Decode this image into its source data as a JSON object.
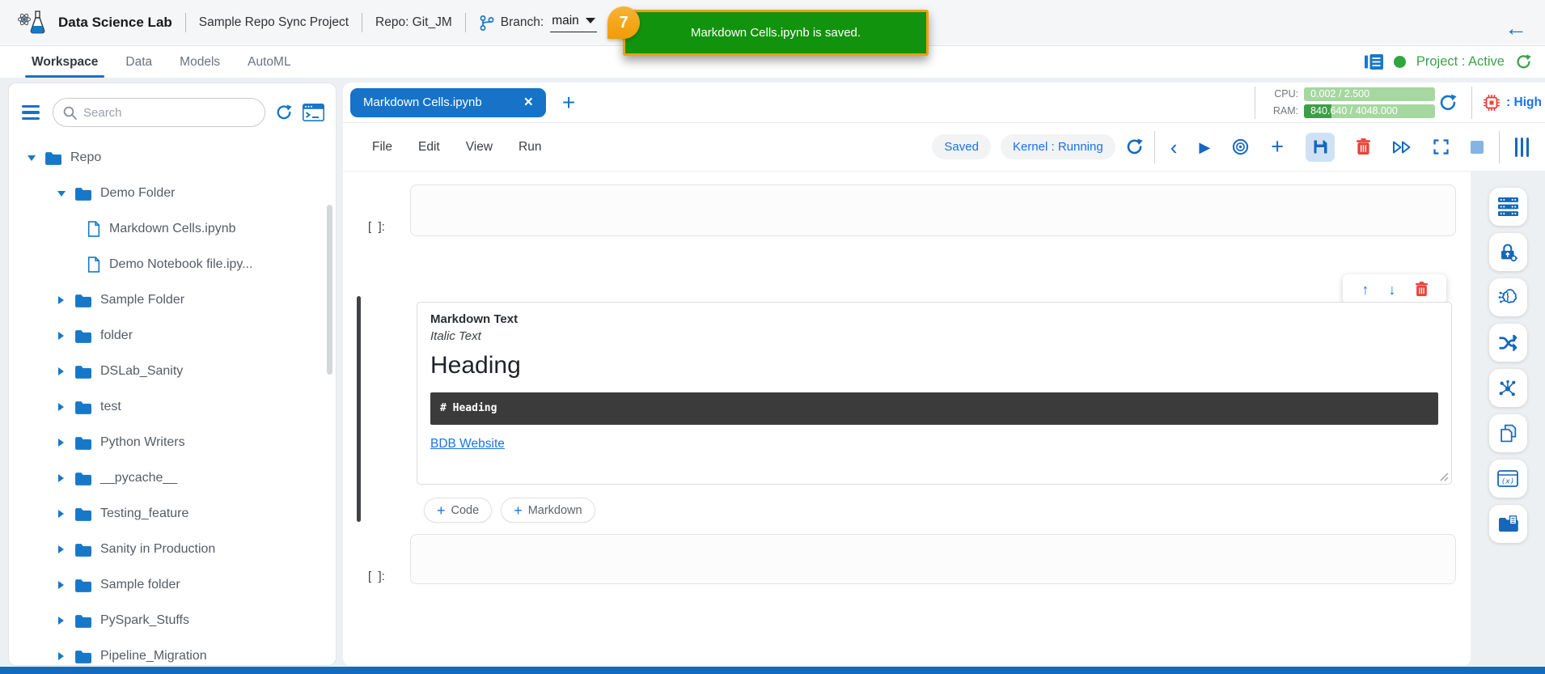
{
  "colors": {
    "accent": "#1673c8",
    "toast_green": "#12930e",
    "badge_orange": "#f0a30a",
    "status_green": "#3fa14b",
    "danger_red": "#e8453c"
  },
  "header": {
    "app_title": "Data Science Lab",
    "project_name": "Sample Repo Sync Project",
    "repo_label": "Repo: Git_JM",
    "branch_label": "Branch:",
    "branch_value": "main",
    "back_icon": "←"
  },
  "toast": {
    "badge": "7",
    "message": "Markdown Cells.ipynb is saved."
  },
  "nav": {
    "tabs": [
      "Workspace",
      "Data",
      "Models",
      "AutoML"
    ],
    "project_status": "Project : Active"
  },
  "sidebar": {
    "search_placeholder": "Search",
    "tree": [
      {
        "label": "Repo",
        "type": "folder",
        "expanded": true
      },
      {
        "label": "Demo Folder",
        "type": "folder",
        "expanded": true
      },
      {
        "label": "Markdown Cells.ipynb",
        "type": "file"
      },
      {
        "label": "Demo Notebook file.ipy...",
        "type": "file"
      },
      {
        "label": "Sample Folder",
        "type": "folder",
        "expanded": false
      },
      {
        "label": "folder",
        "type": "folder",
        "expanded": false
      },
      {
        "label": "DSLab_Sanity",
        "type": "folder",
        "expanded": false
      },
      {
        "label": "test",
        "type": "folder",
        "expanded": false
      },
      {
        "label": "Python Writers",
        "type": "folder",
        "expanded": false
      },
      {
        "label": "__pycache__",
        "type": "folder",
        "expanded": false
      },
      {
        "label": "Testing_feature",
        "type": "folder",
        "expanded": false
      },
      {
        "label": "Sanity in Production",
        "type": "folder",
        "expanded": false
      },
      {
        "label": "Sample folder",
        "type": "folder",
        "expanded": false
      },
      {
        "label": "PySpark_Stuffs",
        "type": "folder",
        "expanded": false
      },
      {
        "label": "Pipeline_Migration",
        "type": "folder",
        "expanded": false
      }
    ]
  },
  "editor": {
    "tab_title": "Markdown Cells.ipynb",
    "close_icon": "×",
    "plus_icon": "+",
    "menus": [
      "File",
      "Edit",
      "View",
      "Run"
    ],
    "save_status": "Saved",
    "kernel_status": "Kernel : Running",
    "toolbar_icons": {
      "back": "‹",
      "play": "▶"
    },
    "resources": {
      "cpu_label": "CPU:",
      "cpu_value": "0.002 / 2.500",
      "ram_label": "RAM:",
      "ram_value": "840.640 / 4048.000",
      "ram_used_pct": 21,
      "priority_label": ": High"
    },
    "prompt": "[  ]:",
    "markdown_cell": {
      "bold_text": "Markdown Text",
      "italic_text": "Italic Text",
      "heading": "Heading",
      "code": "# Heading",
      "link": "BDB Website"
    },
    "cell_toolbar": {
      "up": "↑",
      "down": "↓"
    },
    "add_buttons": {
      "code": "Code",
      "markdown": "Markdown"
    }
  },
  "right_rail": {
    "icons": [
      "server-icon",
      "lock-key-icon",
      "ai-brain-icon",
      "shuffle-icon",
      "network-icon",
      "documents-icon",
      "function-window-icon",
      "folder-report-icon"
    ]
  }
}
